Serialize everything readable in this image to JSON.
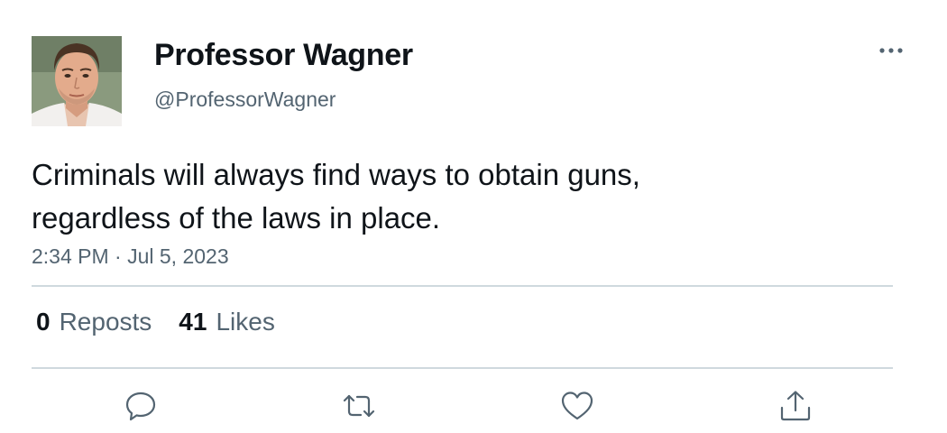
{
  "author": {
    "display_name": "Professor Wagner",
    "handle": "@ProfessorWagner",
    "avatar_icon": "profile-photo"
  },
  "tweet": {
    "text": "Criminals will always find ways to obtain guns, regardless of the laws in place.",
    "timestamp": "2:34 PM · Jul 5, 2023"
  },
  "stats": {
    "reposts_count": "0",
    "reposts_label": "Reposts",
    "likes_count": "41",
    "likes_label": "Likes"
  },
  "actions": {
    "reply_icon": "reply-icon",
    "repost_icon": "repost-icon",
    "like_icon": "heart-icon",
    "share_icon": "share-icon",
    "more_icon": "more-icon"
  },
  "colors": {
    "text_primary": "#0f1419",
    "text_secondary": "#536471",
    "divider": "#cfd9de"
  }
}
